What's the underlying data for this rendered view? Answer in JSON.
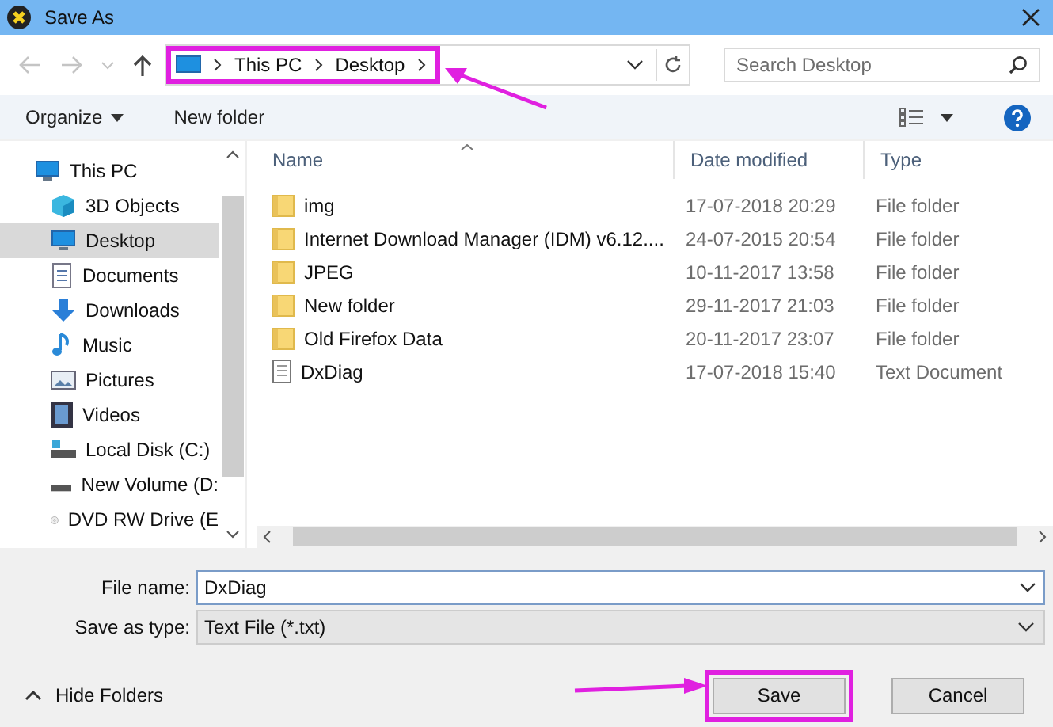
{
  "window": {
    "title": "Save As"
  },
  "address": {
    "crumbs": [
      "This PC",
      "Desktop"
    ]
  },
  "search": {
    "placeholder": "Search Desktop"
  },
  "toolbar": {
    "organize": "Organize",
    "new_folder": "New folder"
  },
  "sidebar": {
    "items": [
      {
        "label": "This PC",
        "kind": "pc",
        "selected": false,
        "children": [
          {
            "label": "3D Objects",
            "kind": "cube",
            "selected": false
          },
          {
            "label": "Desktop",
            "kind": "desktop",
            "selected": true
          },
          {
            "label": "Documents",
            "kind": "document",
            "selected": false
          },
          {
            "label": "Downloads",
            "kind": "download",
            "selected": false
          },
          {
            "label": "Music",
            "kind": "music",
            "selected": false
          },
          {
            "label": "Pictures",
            "kind": "pictures",
            "selected": false
          },
          {
            "label": "Videos",
            "kind": "videos",
            "selected": false
          },
          {
            "label": "Local Disk (C:)",
            "kind": "disk",
            "selected": false
          },
          {
            "label": "New Volume (D:",
            "kind": "drive",
            "selected": false
          },
          {
            "label": "DVD RW Drive (E",
            "kind": "dvd",
            "selected": false
          }
        ]
      }
    ]
  },
  "table": {
    "columns": [
      "Name",
      "Date modified",
      "Type"
    ],
    "rows": [
      {
        "name": "img",
        "date": "17-07-2018 20:29",
        "type": "File folder",
        "kind": "folder"
      },
      {
        "name": "Internet Download Manager (IDM) v6.12....",
        "date": "24-07-2015 20:54",
        "type": "File folder",
        "kind": "folder"
      },
      {
        "name": "JPEG",
        "date": "10-11-2017 13:58",
        "type": "File folder",
        "kind": "folder"
      },
      {
        "name": "New folder",
        "date": "29-11-2017 21:03",
        "type": "File folder",
        "kind": "folder"
      },
      {
        "name": "Old Firefox Data",
        "date": "20-11-2017 23:07",
        "type": "File folder",
        "kind": "folder"
      },
      {
        "name": "DxDiag",
        "date": "17-07-2018 15:40",
        "type": "Text Document",
        "kind": "text"
      }
    ]
  },
  "file_name": {
    "label": "File name:",
    "value": "DxDiag"
  },
  "save_type": {
    "label": "Save as type:",
    "value": "Text File (*.txt)"
  },
  "hide_folders": "Hide Folders",
  "buttons": [
    "Save",
    "Cancel"
  ]
}
